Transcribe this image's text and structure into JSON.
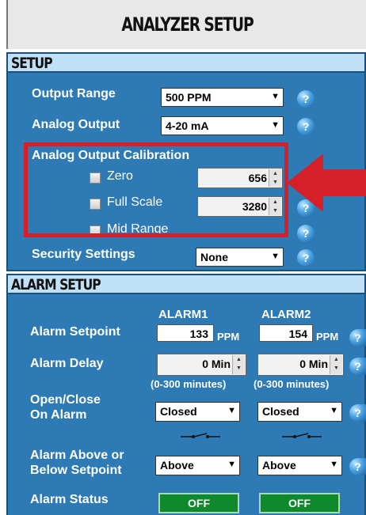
{
  "page_title": "ANALYZER SETUP",
  "setup": {
    "header": "SETUP",
    "output_range": {
      "label": "Output Range",
      "value": "500 PPM"
    },
    "analog_output": {
      "label": "Analog Output",
      "value": "4-20 mA"
    },
    "calibration": {
      "label": "Analog Output Calibration",
      "zero": {
        "label": "Zero",
        "value": "656"
      },
      "full_scale": {
        "label": "Full Scale",
        "value": "3280"
      },
      "mid_range": {
        "label": "Mid Range"
      }
    },
    "security": {
      "label": "Security Settings",
      "value": "None"
    }
  },
  "alarm_setup": {
    "header": "ALARM SETUP",
    "col1": "ALARM1",
    "col2": "ALARM2",
    "setpoint": {
      "label": "Alarm Setpoint",
      "alarm1": "133",
      "alarm2": "154",
      "unit": "PPM"
    },
    "delay": {
      "label": "Alarm Delay",
      "alarm1": "0 Min",
      "alarm2": "0 Min",
      "range": "(0-300 minutes)"
    },
    "open_close": {
      "label_line1": "Open/Close",
      "label_line2": "On Alarm",
      "alarm1": "Closed",
      "alarm2": "Closed"
    },
    "above_below": {
      "label_line1": "Alarm Above or",
      "label_line2": "Below Setpoint",
      "alarm1": "Above",
      "alarm2": "Above"
    },
    "status": {
      "label": "Alarm Status",
      "alarm1": "OFF",
      "alarm2": "OFF"
    }
  },
  "icons": {
    "help": "?"
  },
  "colors": {
    "panel_blue": "#2d7ab5",
    "highlight_red": "#d62029",
    "status_green": "#0e8a2c"
  }
}
